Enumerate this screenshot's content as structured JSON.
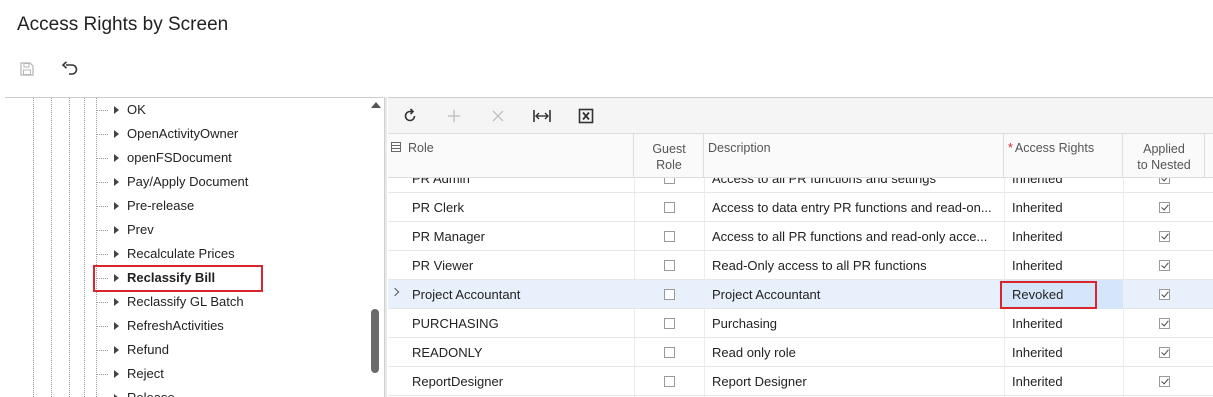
{
  "page": {
    "title": "Access Rights by Screen"
  },
  "toolbar": {
    "save_icon": "save-icon",
    "undo_icon": "undo-icon"
  },
  "tree": {
    "items": [
      {
        "label": "OK",
        "selected": false
      },
      {
        "label": "OpenActivityOwner",
        "selected": false
      },
      {
        "label": "openFSDocument",
        "selected": false
      },
      {
        "label": "Pay/Apply Document",
        "selected": false
      },
      {
        "label": "Pre-release",
        "selected": false
      },
      {
        "label": "Prev",
        "selected": false
      },
      {
        "label": "Recalculate Prices",
        "selected": false
      },
      {
        "label": "Reclassify Bill",
        "selected": true
      },
      {
        "label": "Reclassify GL Batch",
        "selected": false
      },
      {
        "label": "RefreshActivities",
        "selected": false
      },
      {
        "label": "Refund",
        "selected": false
      },
      {
        "label": "Reject",
        "selected": false
      },
      {
        "label": "Release",
        "selected": false
      }
    ]
  },
  "grid": {
    "toolbar_icons": [
      "refresh-icon",
      "add-icon",
      "delete-icon",
      "fit-columns-icon",
      "export-excel-icon"
    ],
    "columns": {
      "role": "Role",
      "guest_role_line1": "Guest",
      "guest_role_line2": "Role",
      "description": "Description",
      "access_rights": "Access Rights",
      "applied_line1": "Applied",
      "applied_line2": "to Nested"
    },
    "rows": [
      {
        "role": "PR Admin",
        "guest": false,
        "description": "Access to all PR functions and settings",
        "access": "Inherited",
        "nested": true
      },
      {
        "role": "PR Clerk",
        "guest": false,
        "description": "Access to data entry PR functions and read-on...",
        "access": "Inherited",
        "nested": true
      },
      {
        "role": "PR Manager",
        "guest": false,
        "description": "Access to all PR functions and read-only acce...",
        "access": "Inherited",
        "nested": true
      },
      {
        "role": "PR Viewer",
        "guest": false,
        "description": "Read-Only access to all PR functions",
        "access": "Inherited",
        "nested": true
      },
      {
        "role": "Project Accountant",
        "guest": false,
        "description": "Project Accountant",
        "access": "Revoked",
        "nested": true
      },
      {
        "role": "PURCHASING",
        "guest": false,
        "description": "Purchasing",
        "access": "Inherited",
        "nested": true
      },
      {
        "role": "READONLY",
        "guest": false,
        "description": "Read only role",
        "access": "Inherited",
        "nested": true
      },
      {
        "role": "ReportDesigner",
        "guest": false,
        "description": "Report Designer",
        "access": "Inherited",
        "nested": true
      }
    ]
  },
  "colors": {
    "highlight": "#d9262e",
    "active_row": "#e8f0fb",
    "editing_cell": "#d6e6fa"
  }
}
